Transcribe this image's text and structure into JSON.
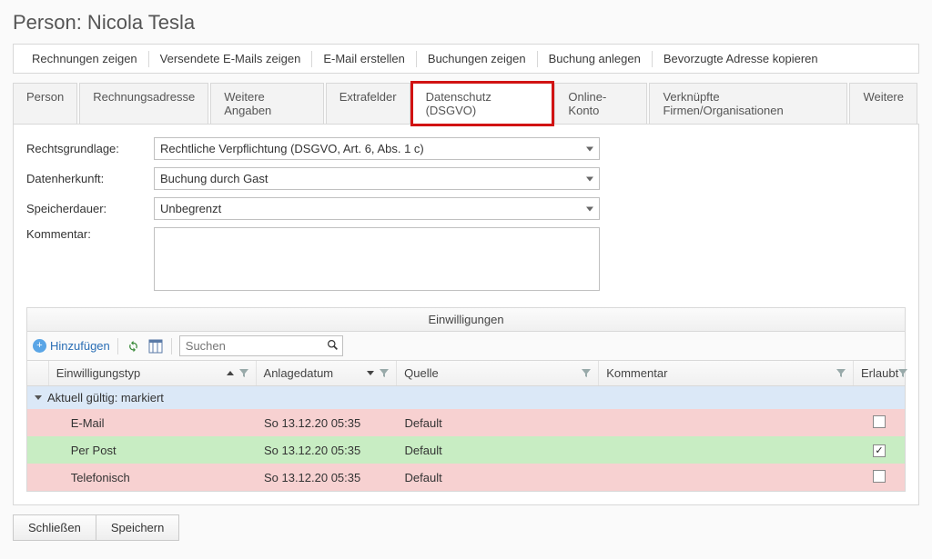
{
  "page_title": "Person: Nicola Tesla",
  "toolbar": {
    "show_invoices": "Rechnungen zeigen",
    "show_sent_emails": "Versendete E-Mails zeigen",
    "create_email": "E-Mail erstellen",
    "show_bookings": "Buchungen zeigen",
    "create_booking": "Buchung anlegen",
    "copy_preferred_address": "Bevorzugte Adresse kopieren"
  },
  "tabs": {
    "person": "Person",
    "billing_address": "Rechnungsadresse",
    "more_details": "Weitere Angaben",
    "extra_fields": "Extrafelder",
    "data_protection": "Datenschutz (DSGVO)",
    "online_account": "Online-Konto",
    "linked_companies": "Verknüpfte Firmen/Organisationen",
    "more": "Weitere"
  },
  "form": {
    "legal_basis_label": "Rechtsgrundlage:",
    "legal_basis_value": "Rechtliche Verpflichtung (DSGVO, Art. 6, Abs. 1 c)",
    "data_origin_label": "Datenherkunft:",
    "data_origin_value": "Buchung durch Gast",
    "retention_label": "Speicherdauer:",
    "retention_value": "Unbegrenzt",
    "comment_label": "Kommentar:"
  },
  "consents": {
    "panel_title": "Einwilligungen",
    "add_label": "Hinzufügen",
    "search_placeholder": "Suchen",
    "columns": {
      "type": "Einwilligungstyp",
      "created": "Anlagedatum",
      "source": "Quelle",
      "comment": "Kommentar",
      "allowed": "Erlaubt"
    },
    "group_label": "Aktuell gültig: markiert",
    "rows": [
      {
        "type": "E-Mail",
        "created": "So 13.12.20 05:35",
        "source": "Default",
        "comment": "",
        "allowed": false
      },
      {
        "type": "Per Post",
        "created": "So 13.12.20 05:35",
        "source": "Default",
        "comment": "",
        "allowed": true
      },
      {
        "type": "Telefonisch",
        "created": "So 13.12.20 05:35",
        "source": "Default",
        "comment": "",
        "allowed": false
      }
    ]
  },
  "footer": {
    "close": "Schließen",
    "save": "Speichern"
  }
}
